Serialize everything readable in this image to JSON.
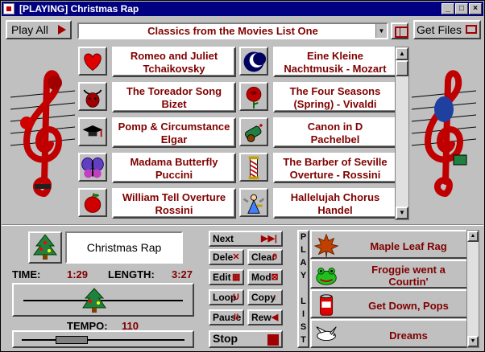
{
  "window": {
    "title": "[PLAYING] Christmas Rap",
    "minimize_label": "_",
    "maximize_label": "□",
    "close_label": "×"
  },
  "toolbar": {
    "play_all_label": "Play All",
    "list_name": "Classics from the Movies List One",
    "get_files_label": "Get Files"
  },
  "songs": [
    {
      "line1": "Romeo and Juliet",
      "line2": "Tchaikovsky",
      "icon": "heart-icon"
    },
    {
      "line1": "Eine Kleine",
      "line2": "Nachtmusik - Mozart",
      "icon": "moon-icon"
    },
    {
      "line1": "The Toreador Song",
      "line2": "Bizet",
      "icon": "bull-icon"
    },
    {
      "line1": "The Four Seasons",
      "line2": "(Spring) - Vivaldi",
      "icon": "rose-icon"
    },
    {
      "line1": "Pomp & Circumstance",
      "line2": "Elgar",
      "icon": "graduation-cap-icon"
    },
    {
      "line1": "Canon in D",
      "line2": "Pachelbel",
      "icon": "cannon-icon"
    },
    {
      "line1": "Madama Butterfly",
      "line2": "Puccini",
      "icon": "butterfly-icon"
    },
    {
      "line1": "The Barber of Seville",
      "line2": "Overture - Rossini",
      "icon": "barber-pole-icon"
    },
    {
      "line1": "William Tell Overture",
      "line2": "Rossini",
      "icon": "apple-icon"
    },
    {
      "line1": "Hallelujah Chorus",
      "line2": "Handel",
      "icon": "angel-icon"
    }
  ],
  "now_playing": {
    "title": "Christmas Rap",
    "icon": "christmas-tree-icon",
    "time_label": "TIME:",
    "time_value": "1:29",
    "length_label": "LENGTH:",
    "length_value": "3:27",
    "progress_fraction": 0.43,
    "tempo_label": "TEMPO:",
    "tempo_value": "110",
    "tempo_fraction": 0.26
  },
  "controls": {
    "next": "Next",
    "delete": "Dele",
    "clear": "Clear",
    "edit": "Edit",
    "mod": "Mod",
    "loop": "Loop",
    "copy": "Copy",
    "pause": "Pause",
    "rew": "Rew",
    "stop": "Stop"
  },
  "playlist": {
    "side_label": [
      "P",
      "L",
      "A",
      "Y",
      "",
      "L",
      "I",
      "S",
      "T"
    ],
    "items": [
      {
        "line1": "Maple Leaf Rag",
        "line2": "",
        "icon": "maple-leaf-icon"
      },
      {
        "line1": "Froggie went a",
        "line2": "Courtin'",
        "icon": "frog-icon"
      },
      {
        "line1": "Get Down, Pops",
        "line2": "",
        "icon": "soda-can-icon"
      },
      {
        "line1": "Dreams",
        "line2": "",
        "icon": "dove-icon"
      }
    ]
  },
  "colors": {
    "title_bar": "#000080",
    "accent_text": "#800000",
    "button_face": "#c0c0c0"
  }
}
